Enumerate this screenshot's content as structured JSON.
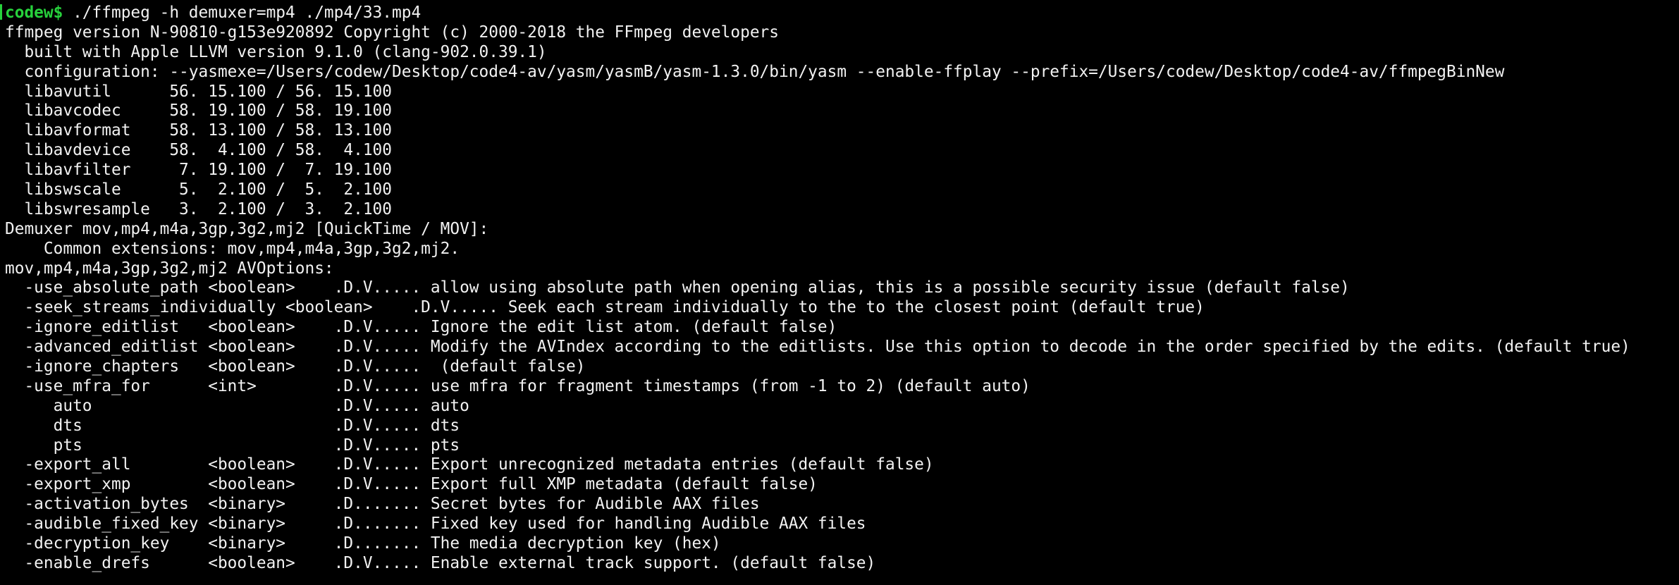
{
  "terminal": {
    "prompt": {
      "user": "codew$",
      "command": " ./ffmpeg -h demuxer=mp4 ./mp4/33.mp4"
    },
    "lines": [
      "ffmpeg version N-90810-g153e920892 Copyright (c) 2000-2018 the FFmpeg developers",
      "  built with Apple LLVM version 9.1.0 (clang-902.0.39.1)",
      "  configuration: --yasmexe=/Users/codew/Desktop/code4-av/yasm/yasmB/yasm-1.3.0/bin/yasm --enable-ffplay --prefix=/Users/codew/Desktop/code4-av/ffmpegBinNew",
      "  libavutil      56. 15.100 / 56. 15.100",
      "  libavcodec     58. 19.100 / 58. 19.100",
      "  libavformat    58. 13.100 / 58. 13.100",
      "  libavdevice    58.  4.100 / 58.  4.100",
      "  libavfilter     7. 19.100 /  7. 19.100",
      "  libswscale      5.  2.100 /  5.  2.100",
      "  libswresample   3.  2.100 /  3.  2.100",
      "Demuxer mov,mp4,m4a,3gp,3g2,mj2 [QuickTime / MOV]:",
      "    Common extensions: mov,mp4,m4a,3gp,3g2,mj2.",
      "mov,mp4,m4a,3gp,3g2,mj2 AVOptions:",
      "  -use_absolute_path <boolean>    .D.V..... allow using absolute path when opening alias, this is a possible security issue (default false)",
      "  -seek_streams_individually <boolean>    .D.V..... Seek each stream individually to the to the closest point (default true)",
      "  -ignore_editlist   <boolean>    .D.V..... Ignore the edit list atom. (default false)",
      "  -advanced_editlist <boolean>    .D.V..... Modify the AVIndex according to the editlists. Use this option to decode in the order specified by the edits. (default true)",
      "  -ignore_chapters   <boolean>    .D.V.....  (default false)",
      "  -use_mfra_for      <int>        .D.V..... use mfra for fragment timestamps (from -1 to 2) (default auto)",
      "     auto                         .D.V..... auto",
      "     dts                          .D.V..... dts",
      "     pts                          .D.V..... pts",
      "  -export_all        <boolean>    .D.V..... Export unrecognized metadata entries (default false)",
      "  -export_xmp        <boolean>    .D.V..... Export full XMP metadata (default false)",
      "  -activation_bytes  <binary>     .D....... Secret bytes for Audible AAX files",
      "  -audible_fixed_key <binary>     .D....... Fixed key used for handling Audible AAX files",
      "  -decryption_key    <binary>     .D....... The media decryption key (hex)",
      "  -enable_drefs      <boolean>    .D.V..... Enable external track support. (default false)"
    ],
    "colors": {
      "background": "#000000",
      "foreground": "#f2f2f2",
      "prompt": "#27d13c"
    }
  }
}
